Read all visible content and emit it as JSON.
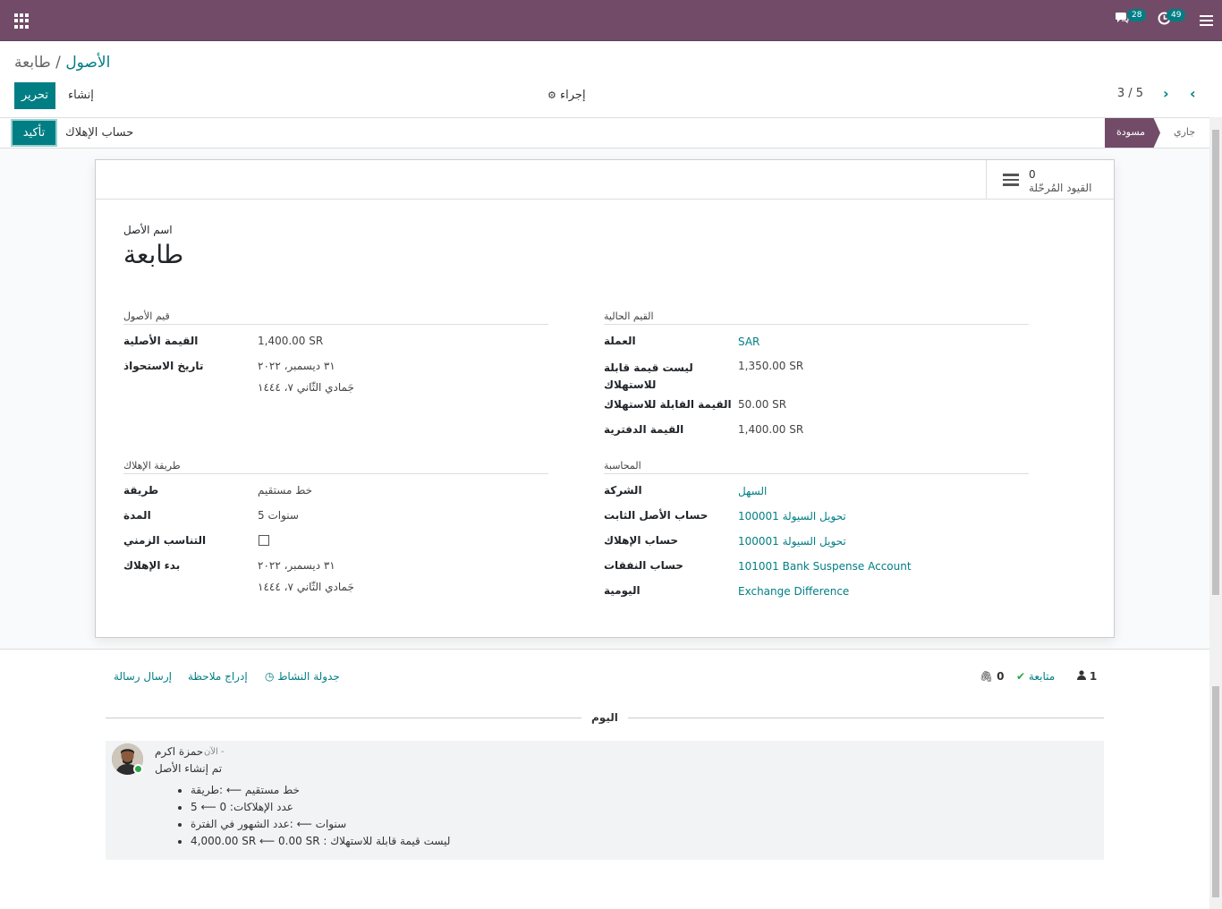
{
  "navbar": {
    "chat_count": "28",
    "activity_count": "49"
  },
  "breadcrumb": {
    "parent": "الأصول",
    "separator": "/",
    "current": "طابعة"
  },
  "control": {
    "edit_label": "تحرير",
    "create_label": "إنشاء",
    "action_label": "إجراء",
    "pager": "3 / 5"
  },
  "statusbar": {
    "confirm_label": "تأكيد",
    "compute_label": "حساب الإهلاك",
    "stages": [
      {
        "label": "مسودة",
        "active": true
      },
      {
        "label": "جاري",
        "active": false
      }
    ]
  },
  "smart_button": {
    "count": "0",
    "label": "القيود المُرحّلة"
  },
  "asset": {
    "name_label": "اسم الأصل",
    "name": "طابعة"
  },
  "asset_values": {
    "title": "قيم الأصول",
    "original_value_label": "القيمة الأصلية",
    "original_value": "1,400.00 SR",
    "acquisition_label": "تاريخ الاستحواذ",
    "acquisition_date": "٣١ ديسمبر، ٢٠٢٢",
    "acquisition_hijri": "جَمادي الثّاني ٧، ١٤٤٤"
  },
  "current_values": {
    "title": "القيم الحالية",
    "currency_label": "العملة",
    "currency": "SAR",
    "non_depreciable_label": "ليست قيمة قابلة للاستهلاك",
    "non_depreciable": "1,350.00 SR",
    "depreciable_label": "القيمة القابلة للاستهلاك",
    "depreciable": "50.00 SR",
    "book_value_label": "القيمة الدفترية",
    "book_value": "1,400.00 SR"
  },
  "depreciation": {
    "title": "طريقة الإهلاك",
    "method_label": "طريقة",
    "method": "خط مستقيم",
    "duration_label": "المدة",
    "duration_value": "5",
    "duration_unit": "سنوات",
    "prorata_label": "التناسب الزمني",
    "start_label": "بدء الإهلاك",
    "start_date": "٣١ ديسمبر، ٢٠٢٢",
    "start_hijri": "جَمادي الثّاني ٧، ١٤٤٤"
  },
  "accounting": {
    "title": "المحاسبة",
    "company_label": "الشركة",
    "company": "السهل",
    "fixed_asset_label": "حساب الأصل الثابت",
    "fixed_asset_account": "100001 تحويل السيولة",
    "depreciation_label": "حساب الإهلاك",
    "depreciation_account": "100001 تحويل السيولة",
    "expense_label": "حساب النفقات",
    "expense_account": "101001 Bank Suspense Account",
    "journal_label": "اليومية",
    "journal": "Exchange Difference"
  },
  "chatter": {
    "send_message": "إرسال رسالة",
    "log_note": "إدراج ملاحظة",
    "schedule_activity": "جدولة النشاط",
    "attachments": "0",
    "follow": "متابعة",
    "followers": "1",
    "date_separator": "اليوم",
    "message": {
      "author": "حمزة اكرم",
      "time": "الآن -",
      "body": "تم إنشاء الأصل",
      "changes": [
        "خط مستقيم ⟵ :طريقة",
        "5 ⟵ 0 :عدد الإهلاكات",
        "سنوات ⟵ :عدد الشهور في الفترة",
        "4,000.00 SR ⟵ 0.00 SR : ليست قيمة قابلة للاستهلاك"
      ]
    }
  }
}
